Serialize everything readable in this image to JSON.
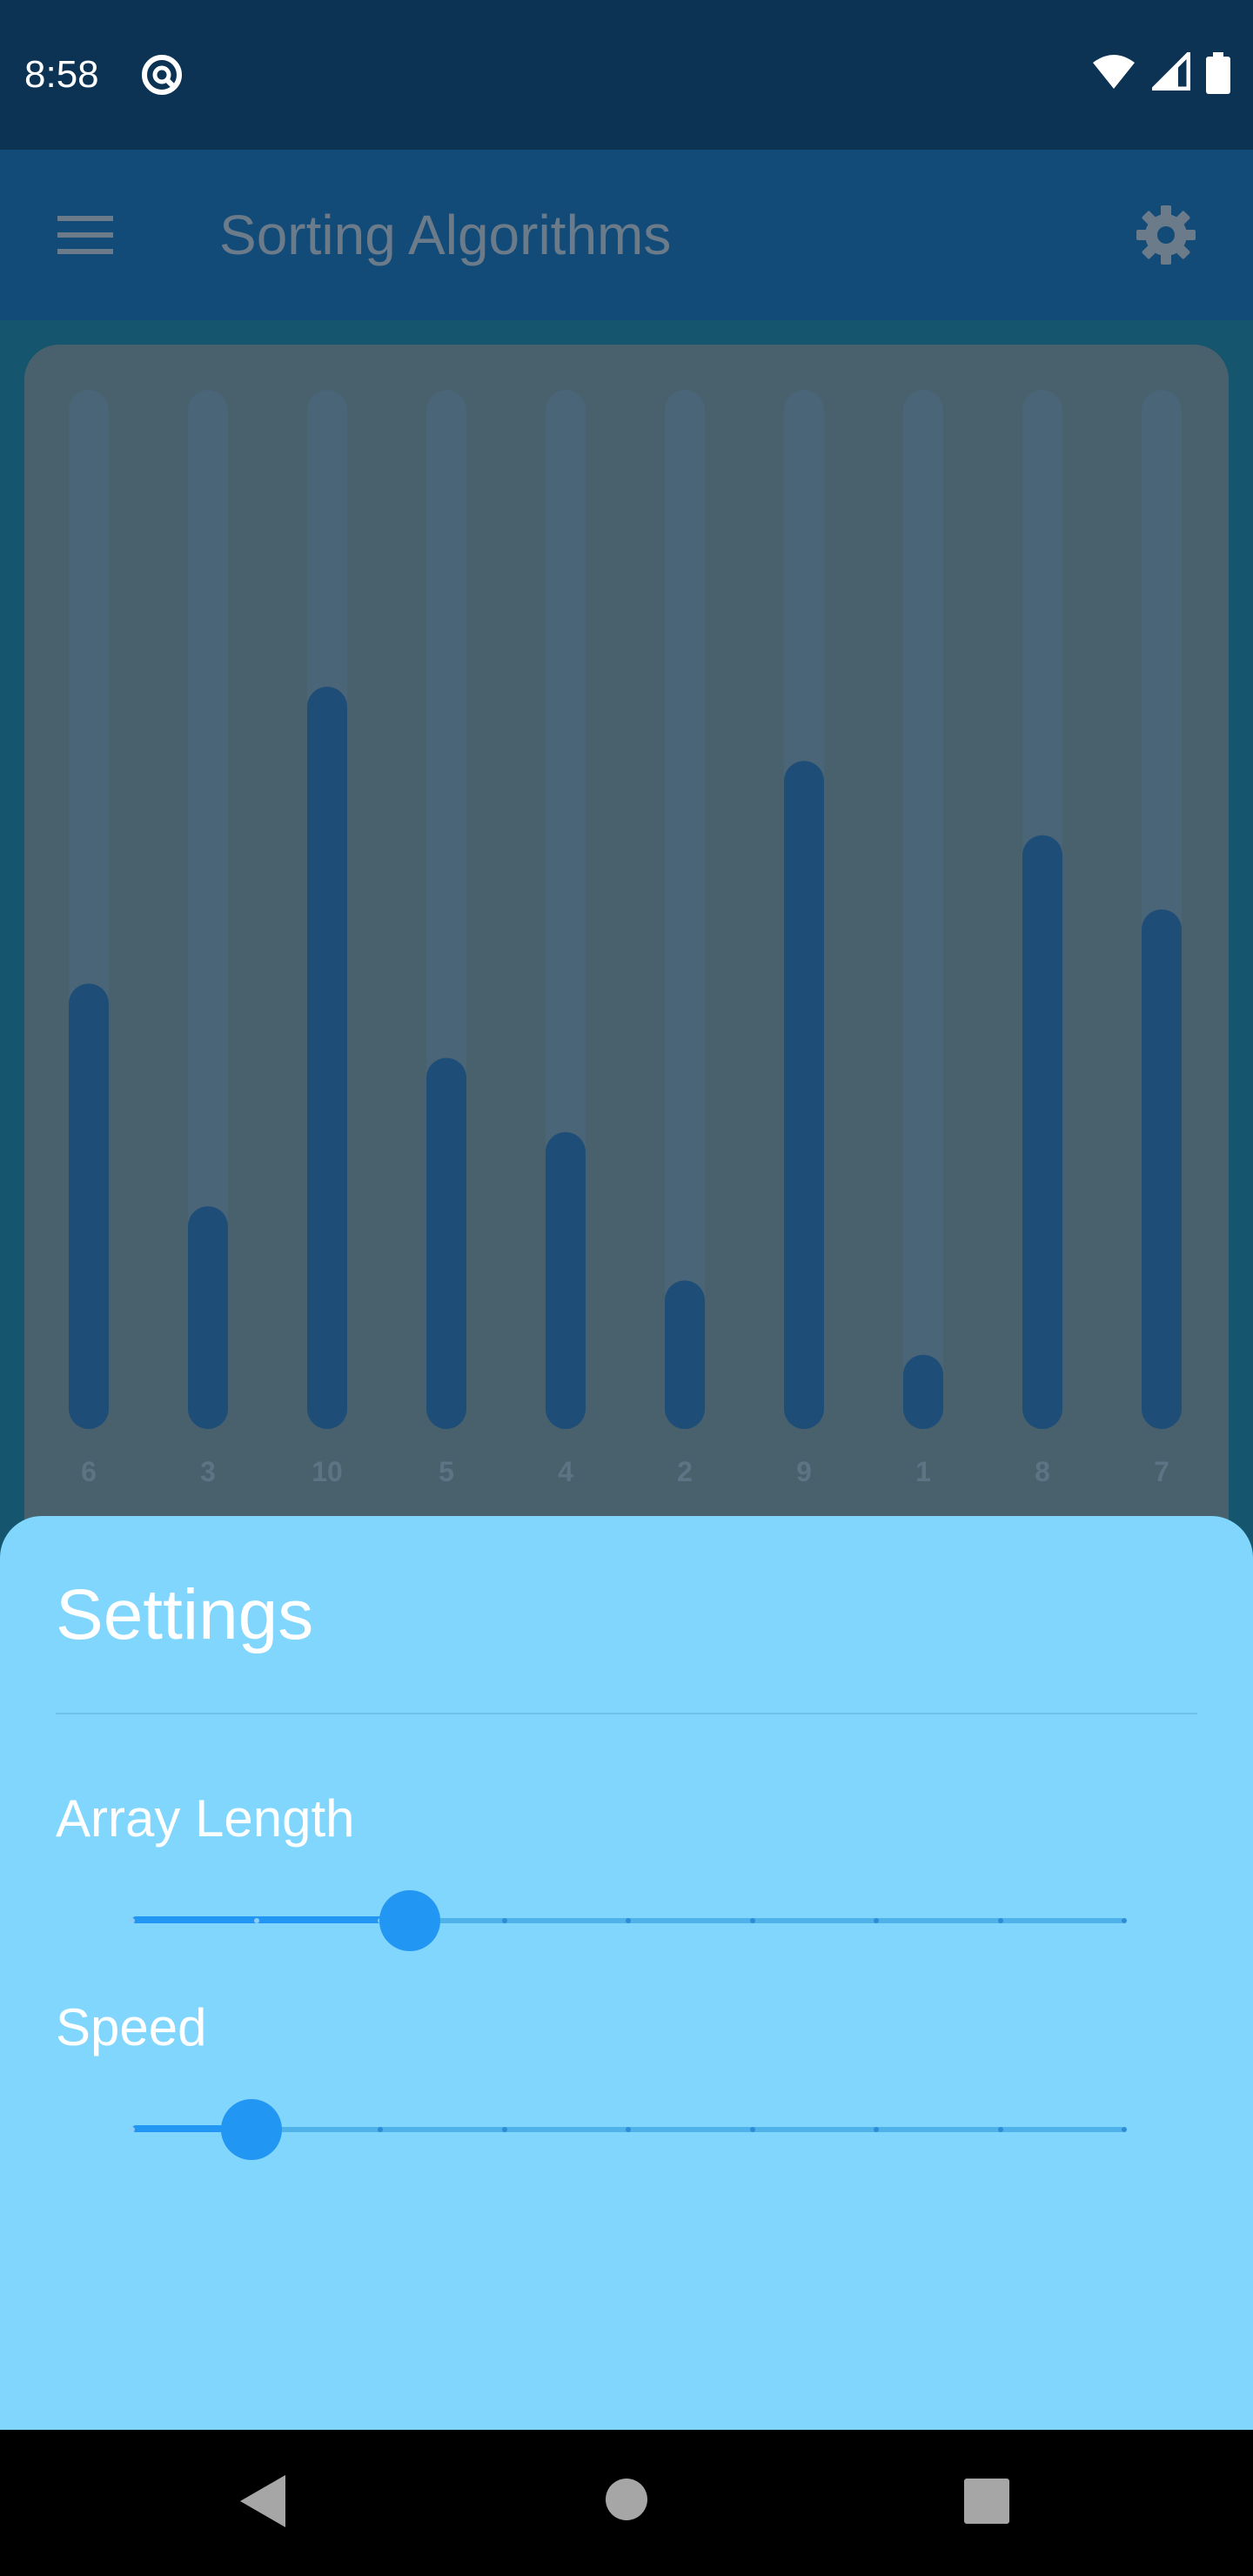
{
  "status_bar": {
    "time": "8:58",
    "icons": [
      "at-sign-icon",
      "wifi-icon",
      "cell-signal-icon",
      "battery-icon"
    ]
  },
  "app_bar": {
    "title": "Sorting Algorithms",
    "menu_icon": "hamburger-menu-icon",
    "settings_icon": "gear-icon"
  },
  "colors": {
    "status_bar": "#0c3254",
    "app_bar": "#124a78",
    "card": "#48616d",
    "bar_fill": "#1e4e77",
    "bar_track": "#4a6478",
    "sheet": "#80d6fc",
    "accent": "#2196f3"
  },
  "chart_data": {
    "type": "bar",
    "categories": [
      "6",
      "3",
      "10",
      "5",
      "4",
      "2",
      "9",
      "1",
      "8",
      "7"
    ],
    "values": [
      6,
      3,
      10,
      5,
      4,
      2,
      9,
      1,
      8,
      7
    ],
    "ylim": [
      0,
      14
    ],
    "grid": false
  },
  "settings_sheet": {
    "title": "Settings",
    "sliders": [
      {
        "label": "Array Length",
        "value_fraction": 0.28,
        "steps": 8
      },
      {
        "label": "Speed",
        "value_fraction": 0.12,
        "steps": 8
      }
    ]
  },
  "nav_bar": {
    "icons": [
      "back-icon",
      "home-icon",
      "recent-apps-icon"
    ]
  }
}
